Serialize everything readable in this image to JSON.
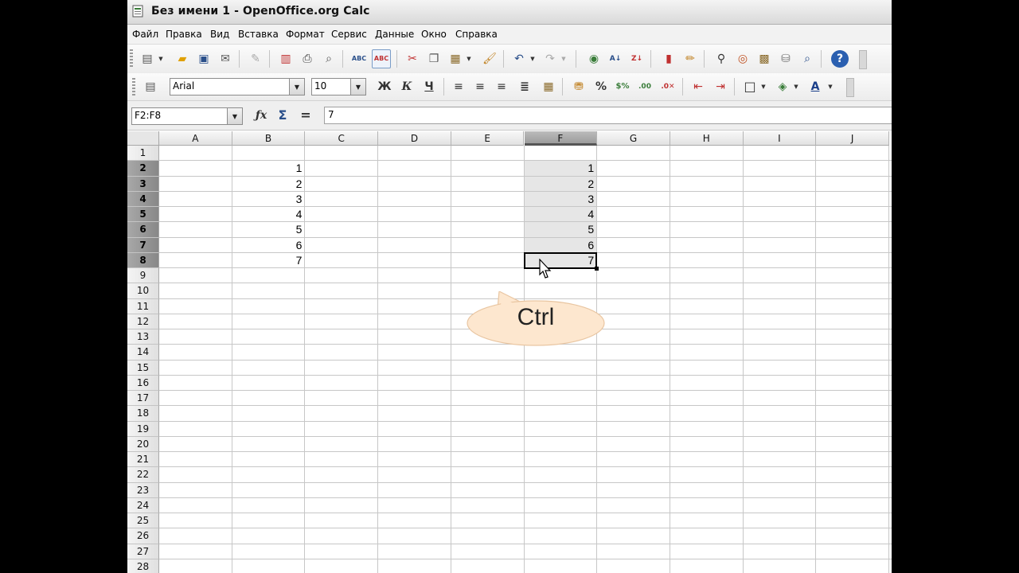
{
  "window": {
    "title": "Без имени 1 - OpenOffice.org Calc"
  },
  "menu": [
    "Файл",
    "Правка",
    "Вид",
    "Вставка",
    "Формат",
    "Сервис",
    "Данные",
    "Окно",
    "Справка"
  ],
  "format_toolbar": {
    "font_name": "Arial",
    "font_size": "10",
    "bold_label": "Ж",
    "italic_label": "К",
    "underline_label": "Ч",
    "percent_label": "%"
  },
  "formula_bar": {
    "name_box": "F2:F8",
    "content": "7"
  },
  "sheet": {
    "columns": [
      "A",
      "B",
      "C",
      "D",
      "E",
      "F",
      "G",
      "H",
      "I",
      "J"
    ],
    "selected_column": "F",
    "rows": [
      "1",
      "2",
      "3",
      "4",
      "5",
      "6",
      "7",
      "8",
      "9",
      "10",
      "11",
      "12",
      "13",
      "14",
      "15",
      "16",
      "17",
      "18",
      "19",
      "20",
      "21",
      "22",
      "23",
      "24",
      "25",
      "26",
      "27",
      "28"
    ],
    "selected_rows": [
      "2",
      "3",
      "4",
      "5",
      "6",
      "7",
      "8"
    ],
    "column_b_values": [
      "1",
      "2",
      "3",
      "4",
      "5",
      "6",
      "7"
    ],
    "column_f_values": [
      "1",
      "2",
      "3",
      "4",
      "5",
      "6",
      "7"
    ],
    "active_cell": "F8"
  },
  "overlay": {
    "callout_text": "Ctrl",
    "callout_fill": "#fde7cf",
    "callout_stroke": "#e9c6a2"
  },
  "colors": {
    "selection_fill": "#e6e6e6",
    "selected_header": "#9c9c9c"
  }
}
